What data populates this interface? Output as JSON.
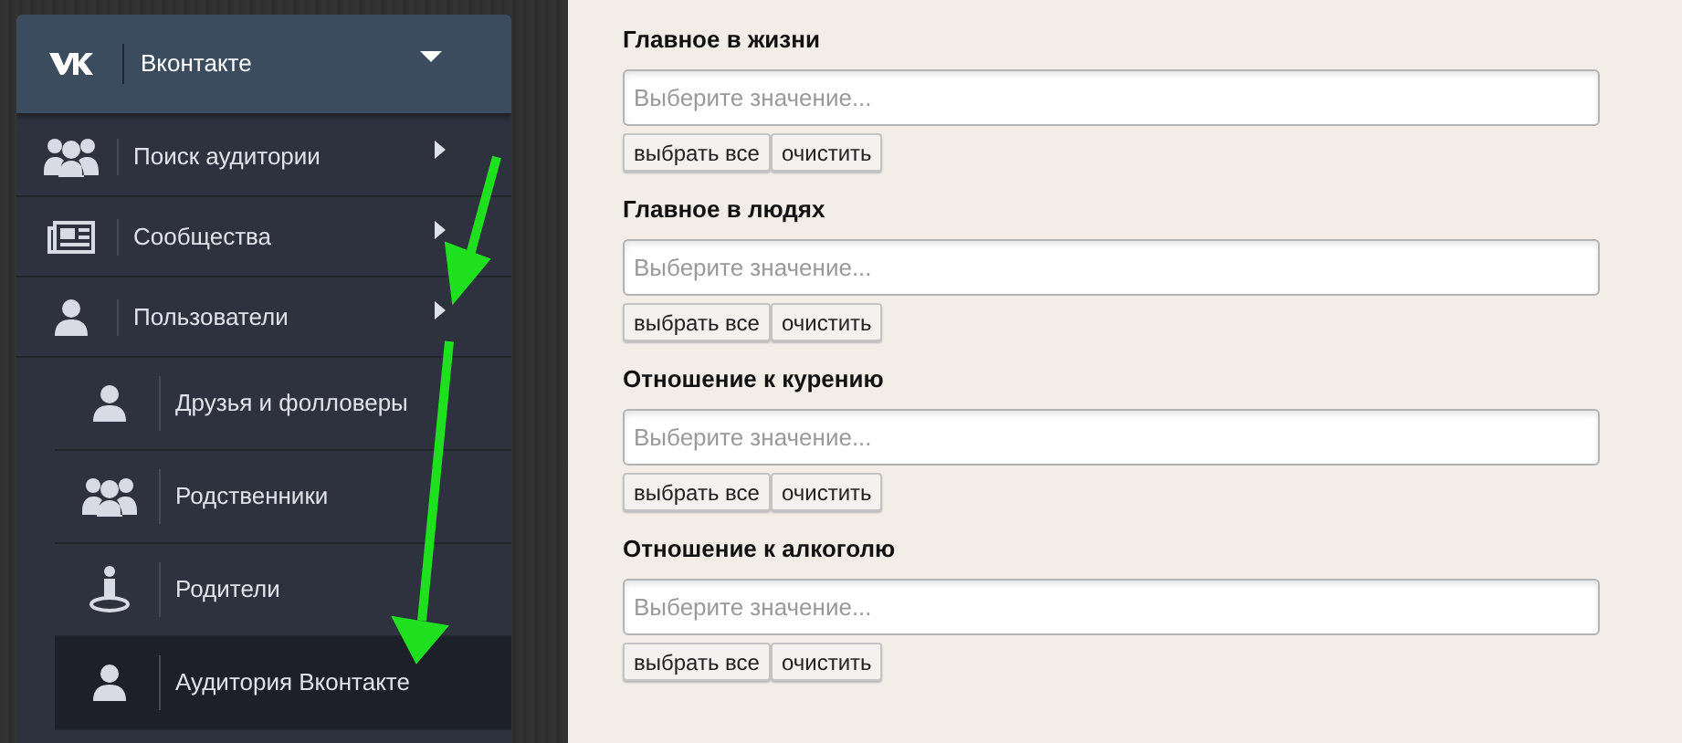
{
  "sidebar": {
    "header": {
      "title": "Вконтакте"
    },
    "items": [
      {
        "label": "Поиск аудитории"
      },
      {
        "label": "Сообщества"
      },
      {
        "label": "Пользователи",
        "children": [
          {
            "label": "Друзья и фолловеры",
            "selected": false
          },
          {
            "label": "Родственники",
            "selected": false
          },
          {
            "label": "Родители",
            "selected": false
          },
          {
            "label": "Аудитория Вконтакте",
            "selected": true
          }
        ]
      }
    ]
  },
  "form": {
    "fields": [
      {
        "label": "Главное в жизни",
        "placeholder": "Выберите значение...",
        "buttons": [
          "выбрать все",
          "очистить"
        ]
      },
      {
        "label": "Главное в людях",
        "placeholder": "Выберите значение...",
        "buttons": [
          "выбрать все",
          "очистить"
        ]
      },
      {
        "label": "Отношение к курению",
        "placeholder": "Выберите значение...",
        "buttons": [
          "выбрать все",
          "очистить"
        ]
      },
      {
        "label": "Отношение к алкоголю",
        "placeholder": "Выберите значение...",
        "buttons": [
          "выбрать все",
          "очистить"
        ]
      }
    ]
  }
}
